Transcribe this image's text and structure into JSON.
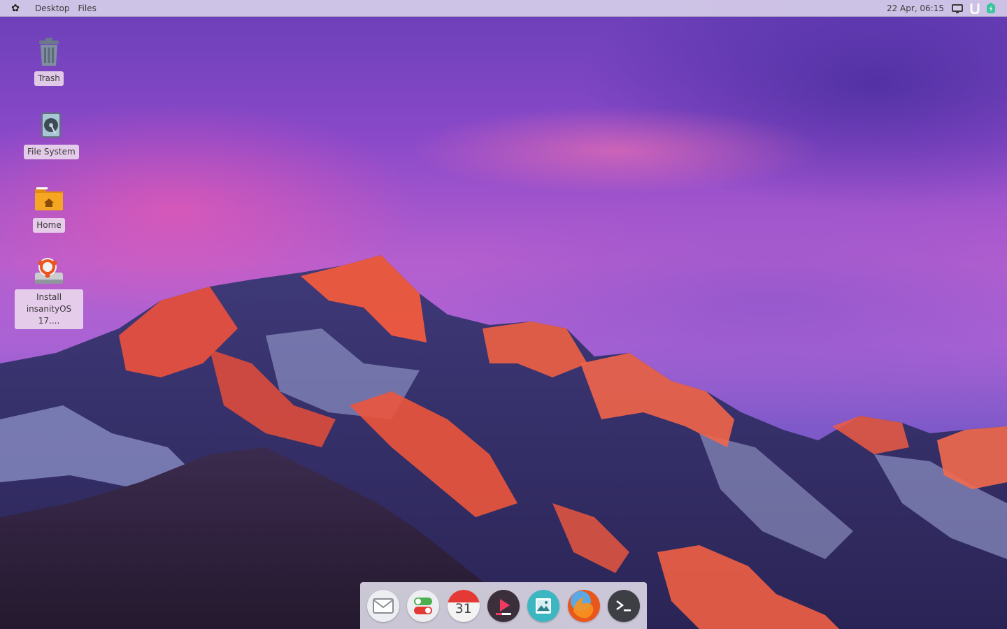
{
  "top_panel": {
    "menus": [
      "Desktop",
      "Files"
    ],
    "clock": "22 Apr, 06:15",
    "tray_icons": [
      "display-icon",
      "network-icon",
      "battery-icon"
    ]
  },
  "desktop": {
    "icons": [
      {
        "label": "Trash",
        "icon": "trash-icon"
      },
      {
        "label": "File System",
        "icon": "drive-icon"
      },
      {
        "label": "Home",
        "icon": "home-folder-icon"
      },
      {
        "label": "Install insanityOS 17....",
        "icon": "installer-icon"
      }
    ]
  },
  "dock": {
    "items": [
      "mail-icon",
      "settings-toggle-icon",
      "calendar-icon",
      "media-player-icon",
      "image-viewer-icon",
      "firefox-icon",
      "terminal-icon"
    ],
    "calendar_day": "31"
  },
  "colors": {
    "panel": "#d6cee9",
    "dock": "#d7d4e2",
    "label_bg": "#e9d6ec",
    "folder_orange": "#f5a623"
  }
}
